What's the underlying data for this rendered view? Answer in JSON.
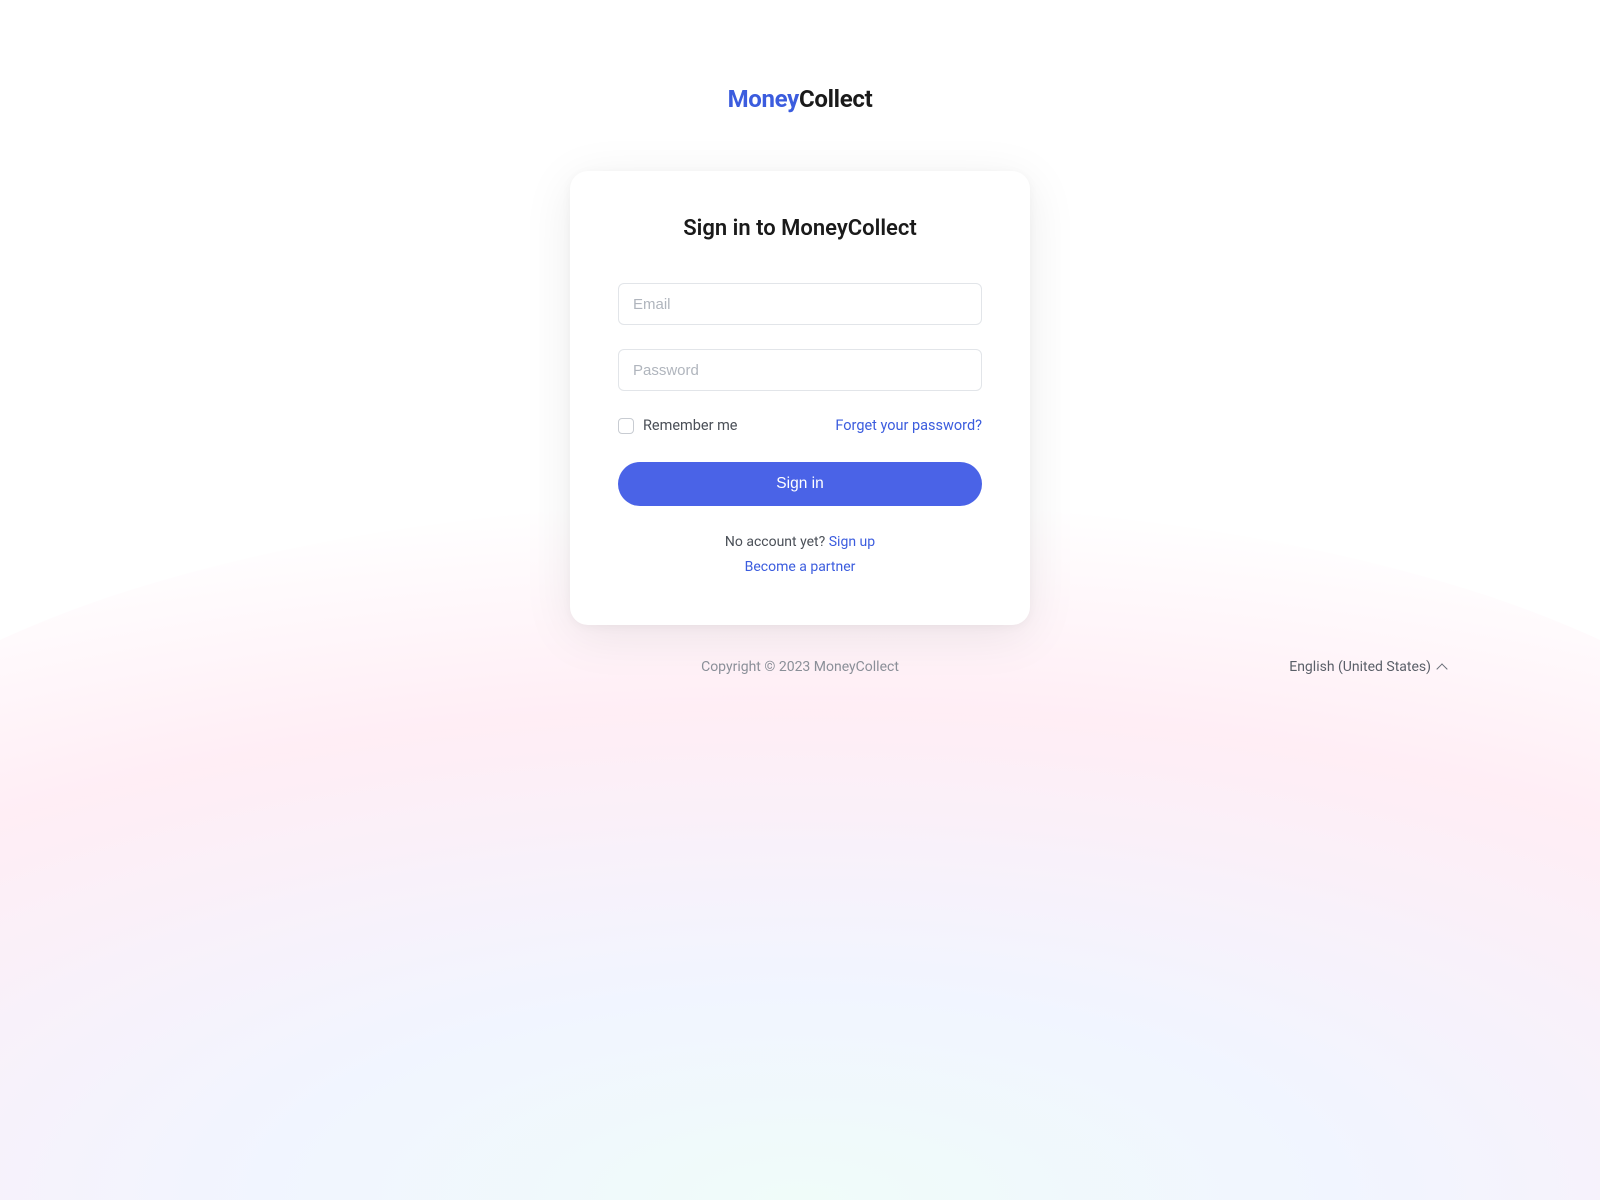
{
  "brand": {
    "part1": "Money",
    "part2": "Collect"
  },
  "card": {
    "title": "Sign in to MoneyCollect",
    "email_placeholder": "Email",
    "email_value": "",
    "password_placeholder": "Password",
    "password_value": "",
    "remember_label": "Remember me",
    "forgot_label": "Forget your password?",
    "signin_label": "Sign in",
    "no_account_text": "No account yet? ",
    "signup_label": "Sign up",
    "partner_label": "Become a partner"
  },
  "footer": {
    "copyright": "Copyright © 2023 MoneyCollect",
    "language": "English (United States)"
  }
}
